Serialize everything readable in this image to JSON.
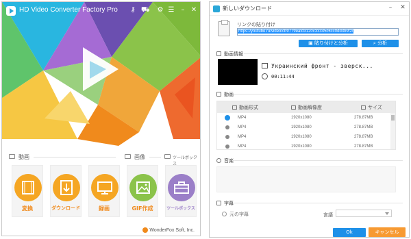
{
  "left": {
    "title": "HD Video Converter Factory Pro",
    "titlebar_icons": [
      "key-icon",
      "cart-icon",
      "gear-icon",
      "list-icon",
      "minimize-icon",
      "close-icon"
    ],
    "categories": {
      "video": "動画",
      "image": "画像",
      "toolbox": "ツールボックス"
    },
    "tiles": [
      {
        "label": "変換",
        "icon": "film-icon",
        "color": "#f5a623"
      },
      {
        "label": "ダウンロード",
        "icon": "download-icon",
        "color": "#f5a623"
      },
      {
        "label": "録画",
        "icon": "monitor-icon",
        "color": "#f5a623"
      },
      {
        "label": "GIF作成",
        "icon": "gif-image-icon",
        "color": "#8bc34a"
      },
      {
        "label": "ツールボックス",
        "icon": "toolbox-icon",
        "color": "#9b7fc8"
      }
    ],
    "footer": "WonderFox Soft, Inc."
  },
  "right": {
    "title": "新しいダウンロード",
    "paste_label": "リンクの貼り付け",
    "url_value": "https://youtube.ru/video/cb9779eafd3120c33345c6cc0dd3b9f2/",
    "paste_analyze_label": "貼り付けと分析",
    "analyze_label": "分析",
    "video_info_header": "動画情報",
    "video_title": "Украинский фронт - зверск...",
    "duration": "00:11:44",
    "video_header": "動画",
    "table_headers": {
      "format": "動画形式",
      "resolution": "動画解像度",
      "size": "サイズ"
    },
    "rows": [
      {
        "format": "MP4",
        "resolution": "1920x1080",
        "size": "278.87MB",
        "selected": true
      },
      {
        "format": "MP4",
        "resolution": "1920x1080",
        "size": "278.87MB",
        "selected": false
      },
      {
        "format": "MP4",
        "resolution": "1920x1080",
        "size": "278.87MB",
        "selected": false
      },
      {
        "format": "MP4",
        "resolution": "1920x1080",
        "size": "278.87MB",
        "selected": false
      }
    ],
    "audio_header": "音楽",
    "subtitle_header": "字幕",
    "subtitle_option": "元の字幕",
    "language_label": "言語",
    "ok_label": "Ok",
    "cancel_label": "キャンセル"
  },
  "colors": {
    "accent_blue": "#1e90e8",
    "accent_orange": "#f79a32"
  }
}
